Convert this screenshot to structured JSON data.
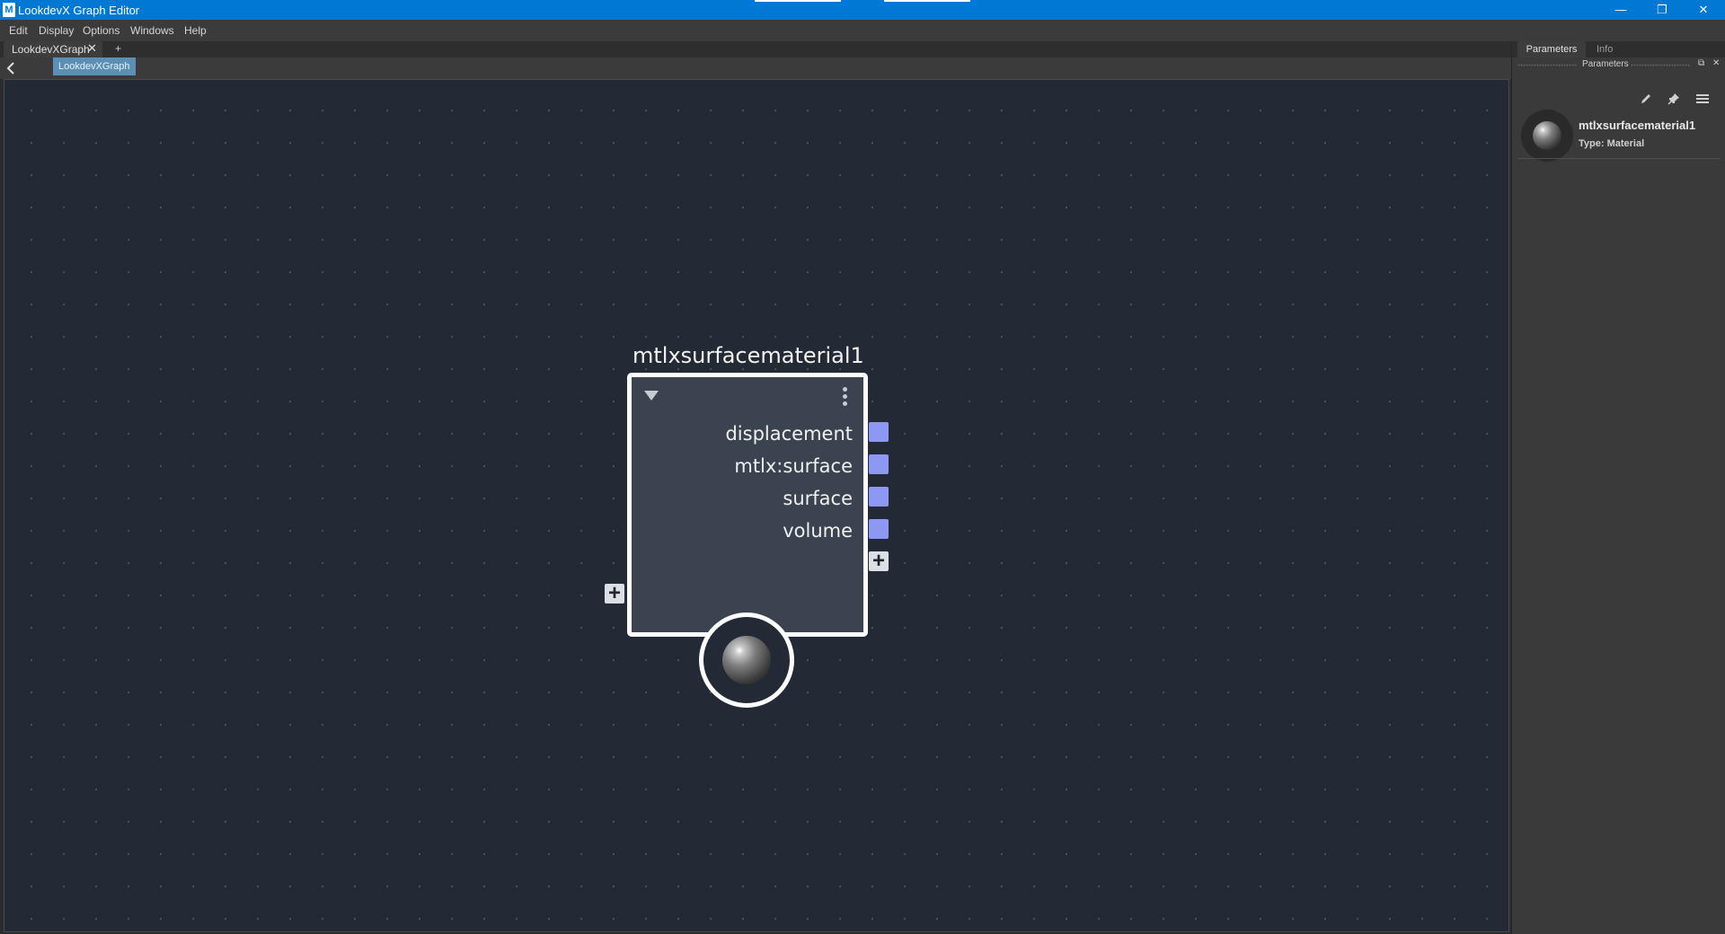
{
  "window": {
    "title": "LookdevX Graph Editor",
    "icon_letter": "M",
    "controls": {
      "minimize": "—",
      "restore": "❐",
      "close": "✕"
    }
  },
  "menu": [
    "Edit",
    "Display",
    "Options",
    "Windows",
    "Help"
  ],
  "tabs": {
    "graph_tab": "LookdevXGraph",
    "close_glyph": "✕",
    "add_glyph": "+"
  },
  "breadcrumb": "LookdevXGraph",
  "node": {
    "title": "mtlxsurfacematerial1",
    "outputs": [
      "displacement",
      "mtlx:surface",
      "surface",
      "volume"
    ],
    "add_glyph": "+",
    "port_color": "#8d98f3"
  },
  "panel": {
    "tabs": [
      "Parameters",
      "Info"
    ],
    "header_title": "Parameters",
    "header_buttons": {
      "float": "⧉",
      "close": "✕"
    },
    "material_name": "mtlxsurfacematerial1",
    "material_type": "Type: Material",
    "tool_icons": [
      "pencil-icon",
      "pin-icon",
      "hamburger-menu-icon"
    ]
  },
  "colors": {
    "titlebar": "#0078d4",
    "canvas": "#232a35",
    "selection": "#5b8fb4"
  }
}
